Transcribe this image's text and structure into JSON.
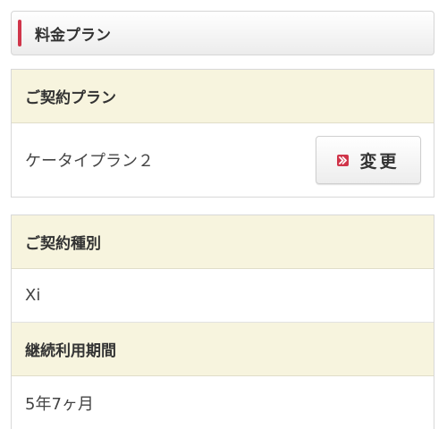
{
  "header": {
    "title": "料金プラン",
    "accent_color": "#d0354a"
  },
  "contract_plan": {
    "heading": "ご契約プラン",
    "value": "ケータイプラン２",
    "change_button": {
      "label": "変更",
      "icon": "arrow-right-icon"
    }
  },
  "contract_info": {
    "sections": [
      {
        "heading": "ご契約種別",
        "value": "Xi"
      },
      {
        "heading": "継続利用期間",
        "value": "5年7ヶ月"
      }
    ]
  },
  "colors": {
    "section_header_bg": "#f7f4de",
    "accent": "#d0354a"
  }
}
